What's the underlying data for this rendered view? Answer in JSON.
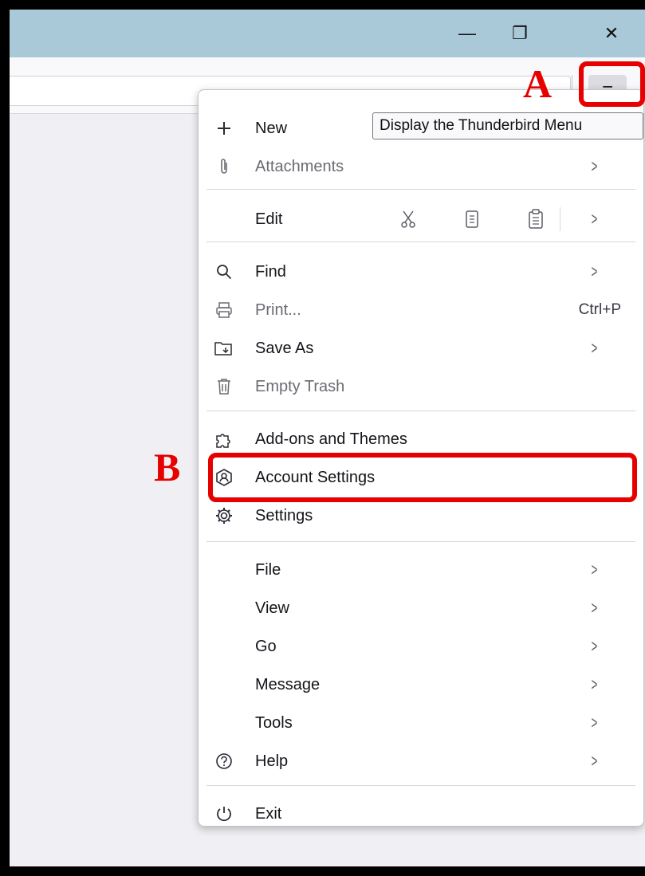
{
  "window_controls": {
    "minimize": "—",
    "restore": "❐",
    "close": "✕"
  },
  "menu_button_glyph": "≡",
  "tooltip": "Display the Thunderbird Menu",
  "menu": {
    "new": "New",
    "attachments": "Attachments",
    "edit": "Edit",
    "find": "Find",
    "print": "Print...",
    "print_shortcut": "Ctrl+P",
    "save_as": "Save As",
    "empty_trash": "Empty Trash",
    "addons": "Add-ons and Themes",
    "account_settings": "Account Settings",
    "settings": "Settings",
    "file": "File",
    "view": "View",
    "go": "Go",
    "message": "Message",
    "tools": "Tools",
    "help": "Help",
    "exit": "Exit",
    "arrow": ">"
  },
  "annotations": {
    "a": "A",
    "b": "B"
  },
  "colors": {
    "titlebar": "#a9c9d8",
    "highlight": "#e60000"
  }
}
